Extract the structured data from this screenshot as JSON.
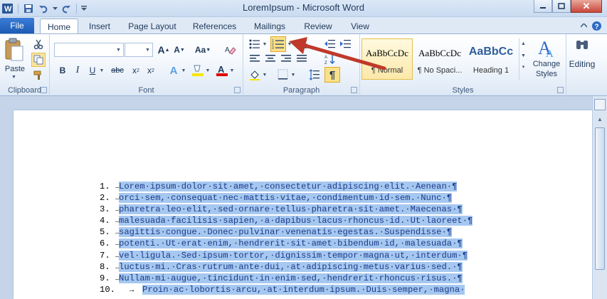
{
  "window": {
    "title": "LoremIpsum  -  Microsoft Word",
    "app_icon": "W"
  },
  "ribbon_tabs": {
    "file": "File",
    "items": [
      "Home",
      "Insert",
      "Page Layout",
      "References",
      "Mailings",
      "Review",
      "View"
    ],
    "active": "Home"
  },
  "clipboard": {
    "paste_label": "Paste",
    "group_label": "Clipboard"
  },
  "font": {
    "name_value": "",
    "size_value": "",
    "group_label": "Font",
    "grow_label": "A",
    "shrink_label": "A",
    "case_label": "Aa",
    "bold": "B",
    "italic": "I",
    "underline": "U",
    "strike": "abc",
    "subscript": "x",
    "subscript_mark": "2",
    "superscript": "x",
    "superscript_mark": "2",
    "effects": "A",
    "highlight": "ab",
    "color": "A",
    "highlight_color": "#f7e600",
    "font_color": "#e00000"
  },
  "paragraph": {
    "group_label": "Paragraph",
    "show_marks": "¶",
    "numbering_active": true
  },
  "styles": {
    "group_label": "Styles",
    "tiles": [
      {
        "sample": "AaBbCcDc",
        "name": "¶ Normal",
        "selected": true
      },
      {
        "sample": "AaBbCcDc",
        "name": "¶ No Spaci...",
        "selected": false
      },
      {
        "sample": "AaBbCc",
        "name": "Heading 1",
        "selected": false
      }
    ],
    "change_styles_line1": "Change",
    "change_styles_line2": "Styles",
    "editing_label": "Editing"
  },
  "document": {
    "lines": [
      {
        "num": "1.",
        "text": "Lorem·ipsum·dolor·sit·amet,·consectetur·adipiscing·elit.·Aenean·¶"
      },
      {
        "num": "2.",
        "text": "orci·sem,·consequat·nec·mattis·vitae,·condimentum·id·sem.·Nunc·¶"
      },
      {
        "num": "3.",
        "text": "pharetra·leo·elit,·sed·ornare·tellus·pharetra·sit·amet.·Maecenas·¶"
      },
      {
        "num": "4.",
        "text": "malesuada·facilisis·sapien,·a·dapibus·lacus·rhoncus·id.·Ut·laoreet·¶"
      },
      {
        "num": "5.",
        "text": "sagittis·congue.·Donec·pulvinar·venenatis·egestas.·Suspendisse·¶"
      },
      {
        "num": "6.",
        "text": "potenti.·Ut·erat·enim,·hendrerit·sit·amet·bibendum·id,·malesuada·¶"
      },
      {
        "num": "7.",
        "text": "vel·ligula.·Sed·ipsum·tortor,·dignissim·tempor·magna·ut,·interdum·¶"
      },
      {
        "num": "8.",
        "text": "luctus·mi.·Cras·rutrum·ante·dui,·at·adipiscing·metus·varius·sed.·¶"
      },
      {
        "num": "9.",
        "text": "Nullam·mi·augue,·tincidunt·in·enim·sed,·hendrerit·rhoncus·risus.·¶"
      },
      {
        "num": "10.",
        "text": "Proin·ac·lobortis·arcu,·at·interdum·ipsum.·Duis·semper,·magna·"
      }
    ]
  },
  "colors": {
    "selection": "#a6c8f0",
    "annotation_arrow": "#c0392b"
  }
}
